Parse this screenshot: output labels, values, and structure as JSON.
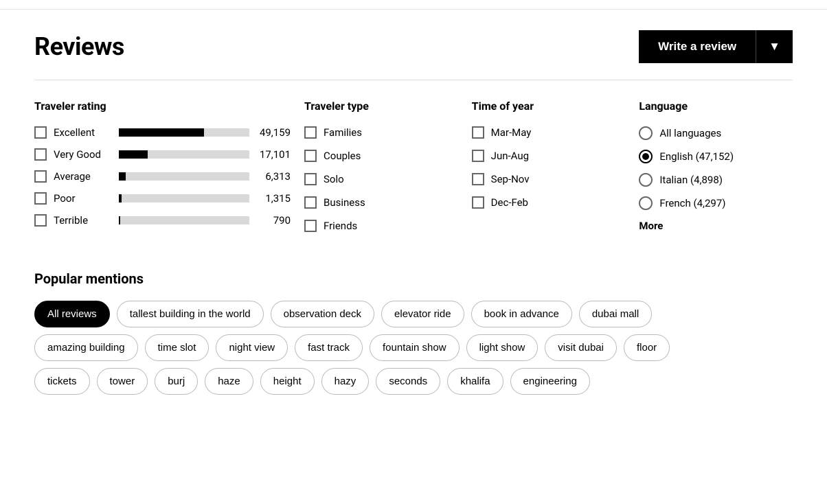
{
  "header": {
    "title": "Reviews",
    "write_review_label": "Write a review",
    "dropdown_icon": "▼"
  },
  "traveler_rating": {
    "title": "Traveler rating",
    "items": [
      {
        "label": "Excellent",
        "count": "49,159",
        "bar_pct": 65
      },
      {
        "label": "Very Good",
        "count": "17,101",
        "bar_pct": 22
      },
      {
        "label": "Average",
        "count": "6,313",
        "bar_pct": 5
      },
      {
        "label": "Poor",
        "count": "1,315",
        "bar_pct": 2
      },
      {
        "label": "Terrible",
        "count": "790",
        "bar_pct": 1
      }
    ]
  },
  "traveler_type": {
    "title": "Traveler type",
    "items": [
      "Families",
      "Couples",
      "Solo",
      "Business",
      "Friends"
    ]
  },
  "time_of_year": {
    "title": "Time of year",
    "items": [
      "Mar-May",
      "Jun-Aug",
      "Sep-Nov",
      "Dec-Feb"
    ]
  },
  "language": {
    "title": "Language",
    "items": [
      {
        "label": "All languages",
        "selected": false
      },
      {
        "label": "English (47,152)",
        "selected": true
      },
      {
        "label": "Italian (4,898)",
        "selected": false
      },
      {
        "label": "French (4,297)",
        "selected": false
      }
    ],
    "more_label": "More"
  },
  "popular_mentions": {
    "title": "Popular mentions",
    "tags_row1": [
      {
        "label": "All reviews",
        "active": true
      },
      {
        "label": "tallest building in the world",
        "active": false
      },
      {
        "label": "observation deck",
        "active": false
      },
      {
        "label": "elevator ride",
        "active": false
      },
      {
        "label": "book in advance",
        "active": false
      },
      {
        "label": "dubai mall",
        "active": false
      }
    ],
    "tags_row2": [
      {
        "label": "amazing building",
        "active": false
      },
      {
        "label": "time slot",
        "active": false
      },
      {
        "label": "night view",
        "active": false
      },
      {
        "label": "fast track",
        "active": false
      },
      {
        "label": "fountain show",
        "active": false
      },
      {
        "label": "light show",
        "active": false
      },
      {
        "label": "visit dubai",
        "active": false
      },
      {
        "label": "floor",
        "active": false
      }
    ],
    "tags_row3": [
      {
        "label": "tickets",
        "active": false
      },
      {
        "label": "tower",
        "active": false
      },
      {
        "label": "burj",
        "active": false
      },
      {
        "label": "haze",
        "active": false
      },
      {
        "label": "height",
        "active": false
      },
      {
        "label": "hazy",
        "active": false
      },
      {
        "label": "seconds",
        "active": false
      },
      {
        "label": "khalifa",
        "active": false
      },
      {
        "label": "engineering",
        "active": false
      }
    ]
  }
}
